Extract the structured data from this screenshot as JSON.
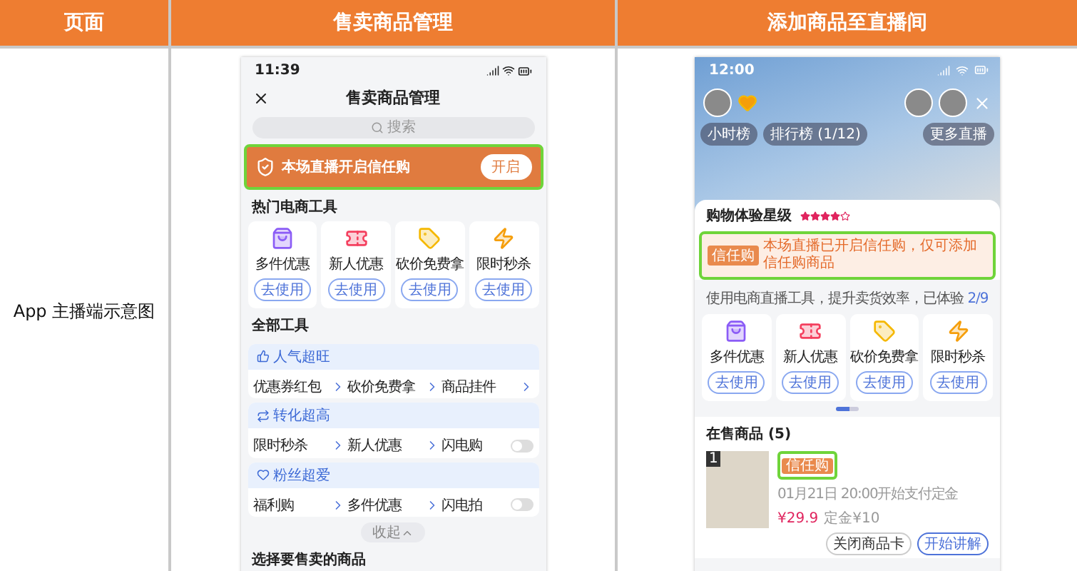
{
  "table": {
    "columns": [
      {
        "label": "页面"
      },
      {
        "label": "售卖商品管理"
      },
      {
        "label": "添加商品至直播间"
      }
    ],
    "row_label": "App 主播端示意图"
  },
  "manage_screen": {
    "status_time": "11:39",
    "title": "售卖商品管理",
    "search": {
      "placeholder": "搜索"
    },
    "trust_banner": {
      "title": "本场直播开启信任购",
      "button": "开启",
      "highlighted": true
    },
    "hot_tools": {
      "title": "热门电商工具",
      "items": [
        {
          "label": "多件优惠",
          "button": "去使用"
        },
        {
          "label": "新人优惠",
          "button": "去使用"
        },
        {
          "label": "砍价免费拿",
          "button": "去使用"
        },
        {
          "label": "限时秒杀",
          "button": "去使用"
        }
      ]
    },
    "all_tools": {
      "title": "全部工具",
      "groups": [
        {
          "title": "人气超旺",
          "items": [
            {
              "kind": "arrow",
              "label": "优惠券红包"
            },
            {
              "kind": "arrow",
              "label": "砍价免费拿"
            },
            {
              "kind": "arrow",
              "label": "商品挂件"
            }
          ]
        },
        {
          "title": "转化超高",
          "items": [
            {
              "kind": "arrow",
              "label": "限时秒杀"
            },
            {
              "kind": "arrow",
              "label": "新人优惠"
            },
            {
              "kind": "toggle",
              "label": "闪电购",
              "on": false
            }
          ]
        },
        {
          "title": "粉丝超爱",
          "items": [
            {
              "kind": "arrow",
              "label": "福利购"
            },
            {
              "kind": "arrow",
              "label": "多件优惠"
            },
            {
              "kind": "toggle",
              "label": "闪电拍",
              "on": false
            }
          ]
        }
      ]
    },
    "collapse": "收起",
    "next_section": "选择要售卖的商品"
  },
  "live_screen": {
    "status_time": "12:00",
    "chips": [
      "小时榜",
      "排行榜 (1/12)"
    ],
    "more_live": "更多直播",
    "rating": {
      "title": "购物体验星级",
      "stars": 4
    },
    "trust_notice": {
      "badge": "信任购",
      "text": "本场直播已开启信任购，仅可添加信任购商品",
      "highlighted": true
    },
    "tools_hint": {
      "text": "使用电商直播工具，提升卖货效率，已体验",
      "progress": "2/9"
    },
    "tools": [
      {
        "label": "多件优惠",
        "button": "去使用"
      },
      {
        "label": "新人优惠",
        "button": "去使用"
      },
      {
        "label": "砍价免费拿",
        "button": "去使用"
      },
      {
        "label": "限时秒杀",
        "button": "去使用"
      }
    ],
    "on_sale": {
      "title": "在售商品 (5)",
      "product": {
        "index": "1",
        "badge": "信任购",
        "badge_highlighted": true,
        "schedule": "01月21日 20:00开始支付定金",
        "price": "¥29.9",
        "deposit": "定金¥10",
        "buttons": [
          "关闭商品卡",
          "开始讲解"
        ]
      }
    }
  }
}
